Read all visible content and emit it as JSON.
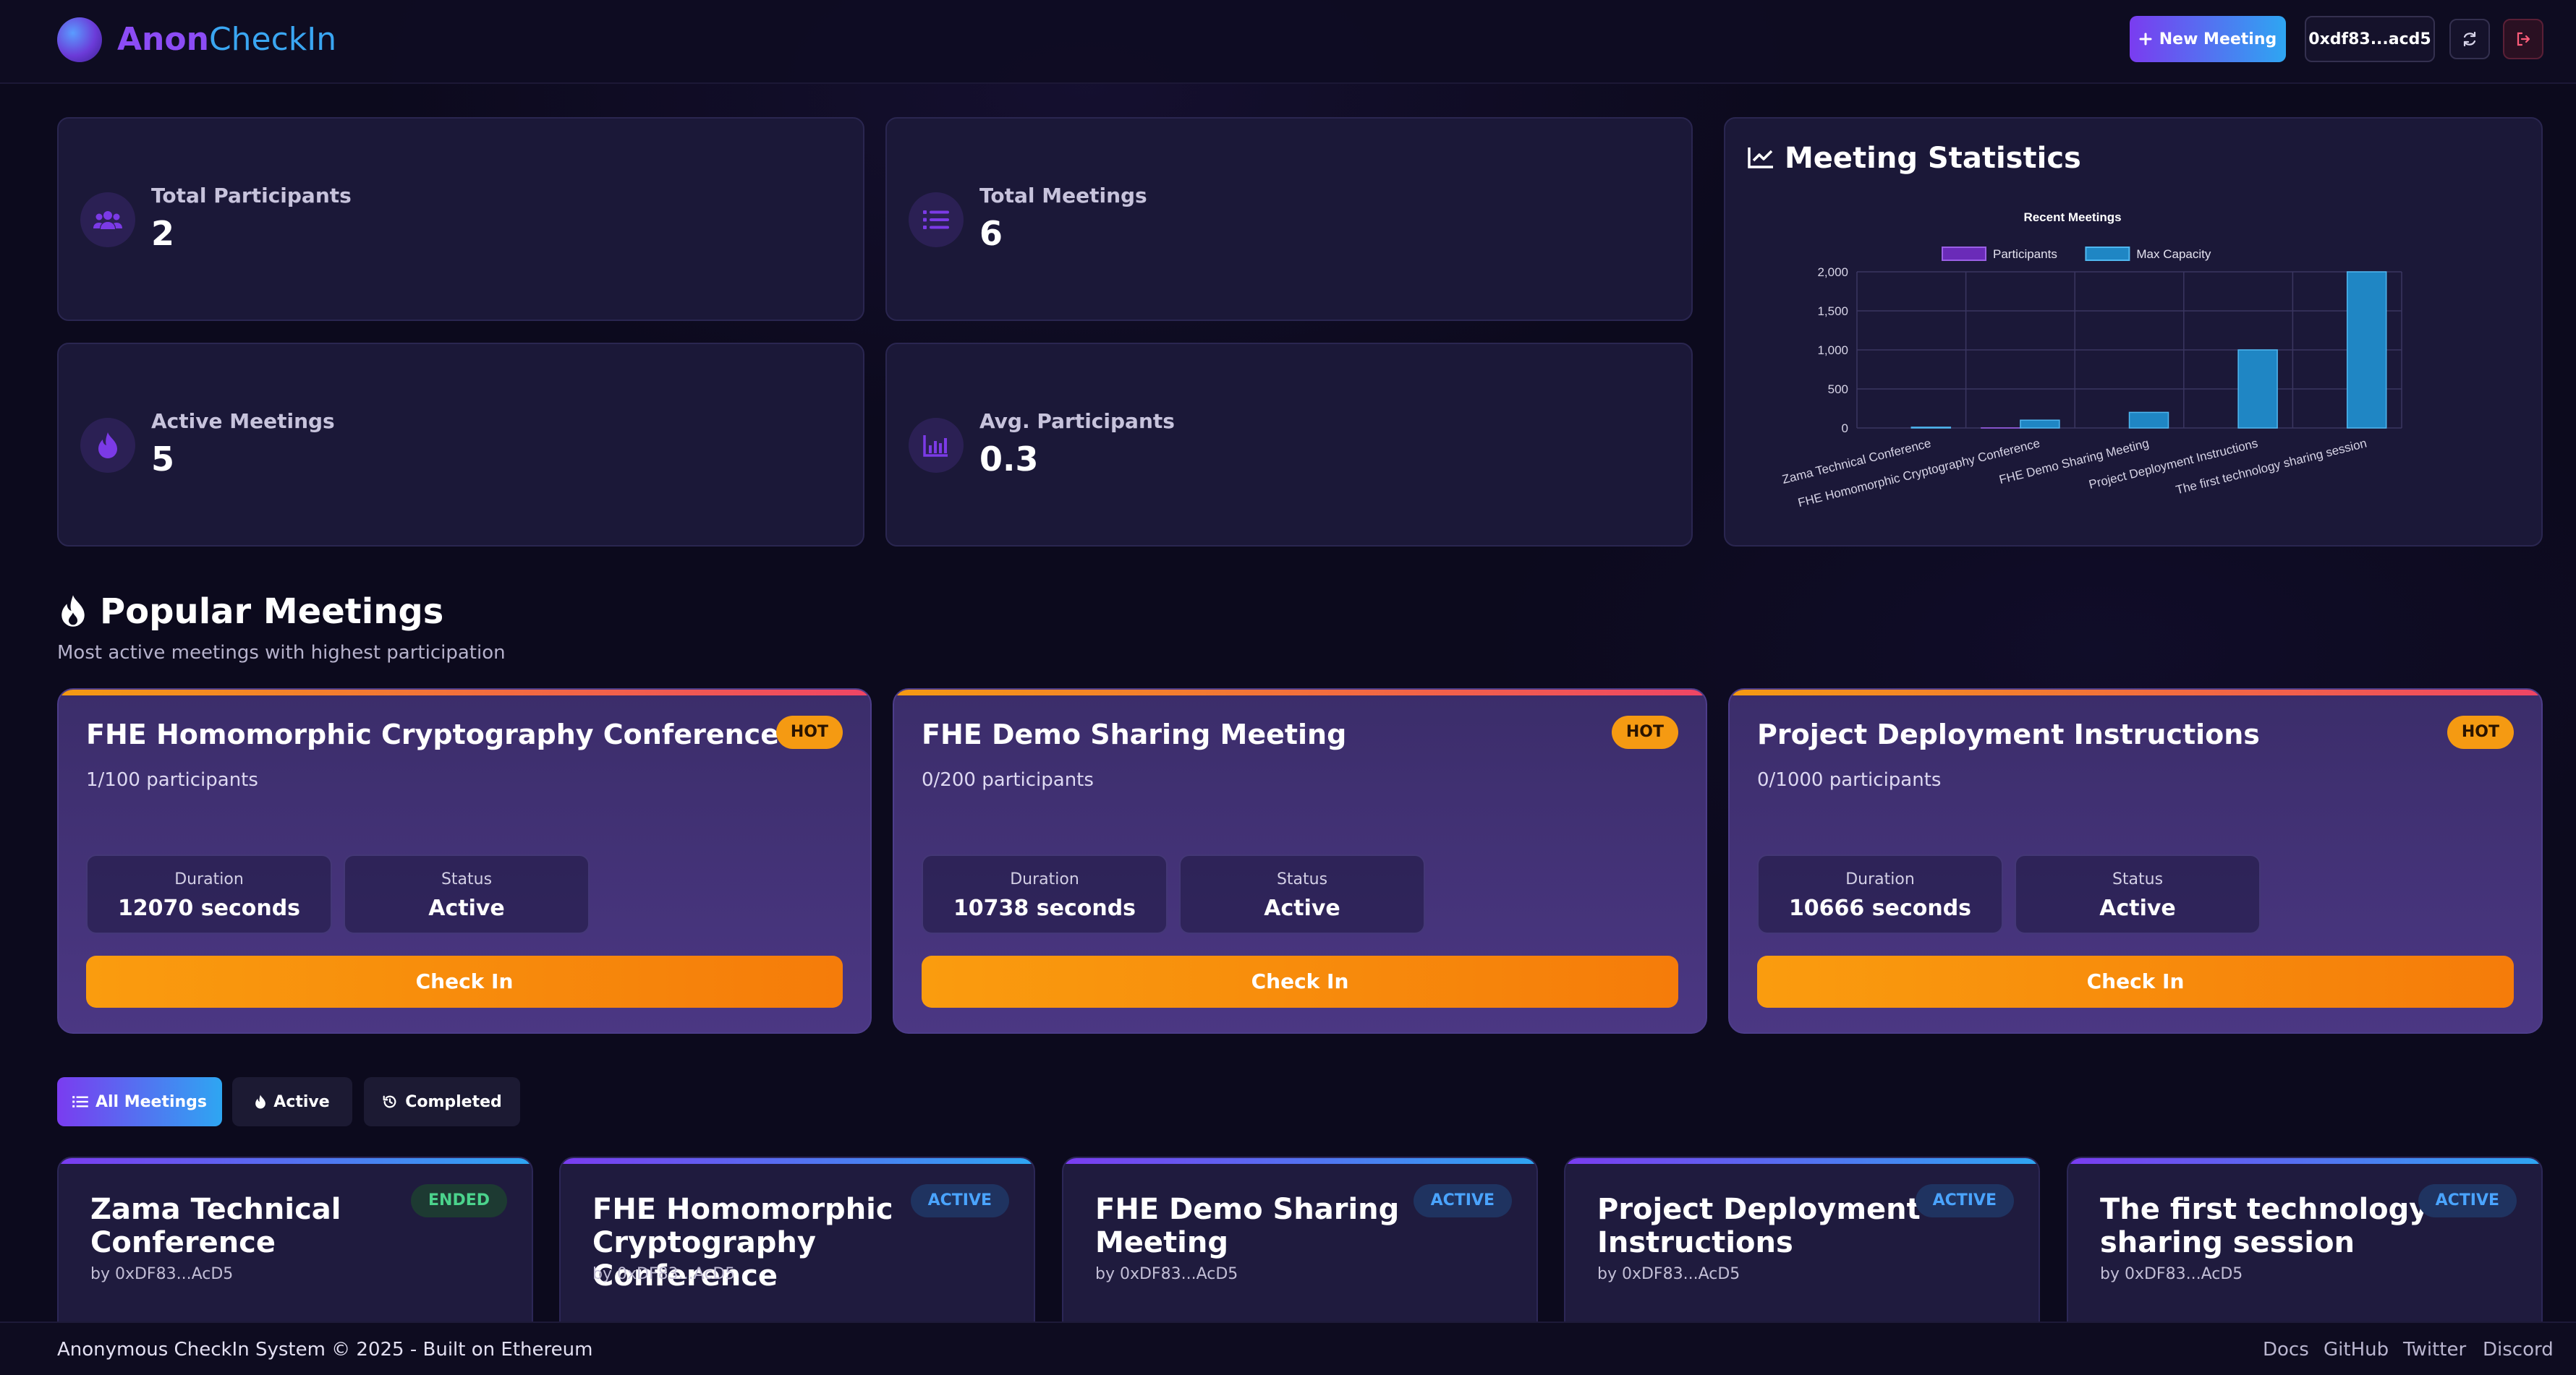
{
  "header": {
    "logo_part1": "Anon",
    "logo_part2": "CheckIn",
    "new_meeting_label": "New Meeting",
    "wallet_address": "0xdf83...acd5"
  },
  "stats": [
    {
      "label": "Total Participants",
      "value": "2",
      "icon": "users-icon"
    },
    {
      "label": "Total Meetings",
      "value": "6",
      "icon": "list-icon"
    },
    {
      "label": "Active Meetings",
      "value": "5",
      "icon": "fire-icon"
    },
    {
      "label": "Avg. Participants",
      "value": "0.3",
      "icon": "bar-chart-icon"
    }
  ],
  "statistics_panel": {
    "title": "Meeting Statistics"
  },
  "chart_data": {
    "type": "bar",
    "title": "Recent Meetings",
    "categories": [
      "Zama Technical Conference",
      "FHE Homomorphic Cryptography Conference",
      "FHE Demo Sharing Meeting",
      "Project Deployment Instructions",
      "The first technology sharing session"
    ],
    "series": [
      {
        "name": "Participants",
        "values": [
          0,
          1,
          0,
          0,
          0
        ],
        "color": "#6a2bb8"
      },
      {
        "name": "Max Capacity",
        "values": [
          10,
          100,
          200,
          1000,
          2000
        ],
        "color": "#1f86c4"
      }
    ],
    "ylim": [
      0,
      2000
    ],
    "yticks": [
      "2,000",
      "1,500",
      "1,000",
      "500",
      "0"
    ],
    "ytick_values": [
      2000,
      1500,
      1000,
      500,
      0
    ],
    "legend_position": "top",
    "grid": true
  },
  "popular": {
    "title": "Popular Meetings",
    "subtitle": "Most active meetings with highest participation",
    "badge": "HOT",
    "duration_label": "Duration",
    "status_label": "Status",
    "checkin_label": "Check In",
    "cards": [
      {
        "title": "FHE Homomorphic Cryptography Conference",
        "participants": "1/100 participants",
        "duration": "12070 seconds",
        "status": "Active"
      },
      {
        "title": "FHE Demo Sharing Meeting",
        "participants": "0/200 participants",
        "duration": "10738 seconds",
        "status": "Active"
      },
      {
        "title": "Project Deployment Instructions",
        "participants": "0/1000 participants",
        "duration": "10666 seconds",
        "status": "Active"
      }
    ]
  },
  "filters": {
    "all": "All Meetings",
    "active": "Active",
    "completed": "Completed"
  },
  "meetings": [
    {
      "title": "Zama Technical Conference",
      "by": "by 0xDF83...AcD5",
      "status": "ENDED"
    },
    {
      "title": "FHE Homomorphic Cryptography Conference",
      "by": "by 0xDF83...AcD5",
      "status": "ACTIVE"
    },
    {
      "title": "FHE Demo Sharing Meeting",
      "by": "by 0xDF83...AcD5",
      "status": "ACTIVE"
    },
    {
      "title": "Project Deployment Instructions",
      "by": "by 0xDF83...AcD5",
      "status": "ACTIVE"
    },
    {
      "title": "The first technology sharing session",
      "by": "by 0xDF83...AcD5",
      "status": "ACTIVE"
    }
  ],
  "footer": {
    "text": "Anonymous CheckIn System © 2025 - Built on Ethereum",
    "links": [
      "Docs",
      "GitHub",
      "Twitter",
      "Discord"
    ]
  }
}
